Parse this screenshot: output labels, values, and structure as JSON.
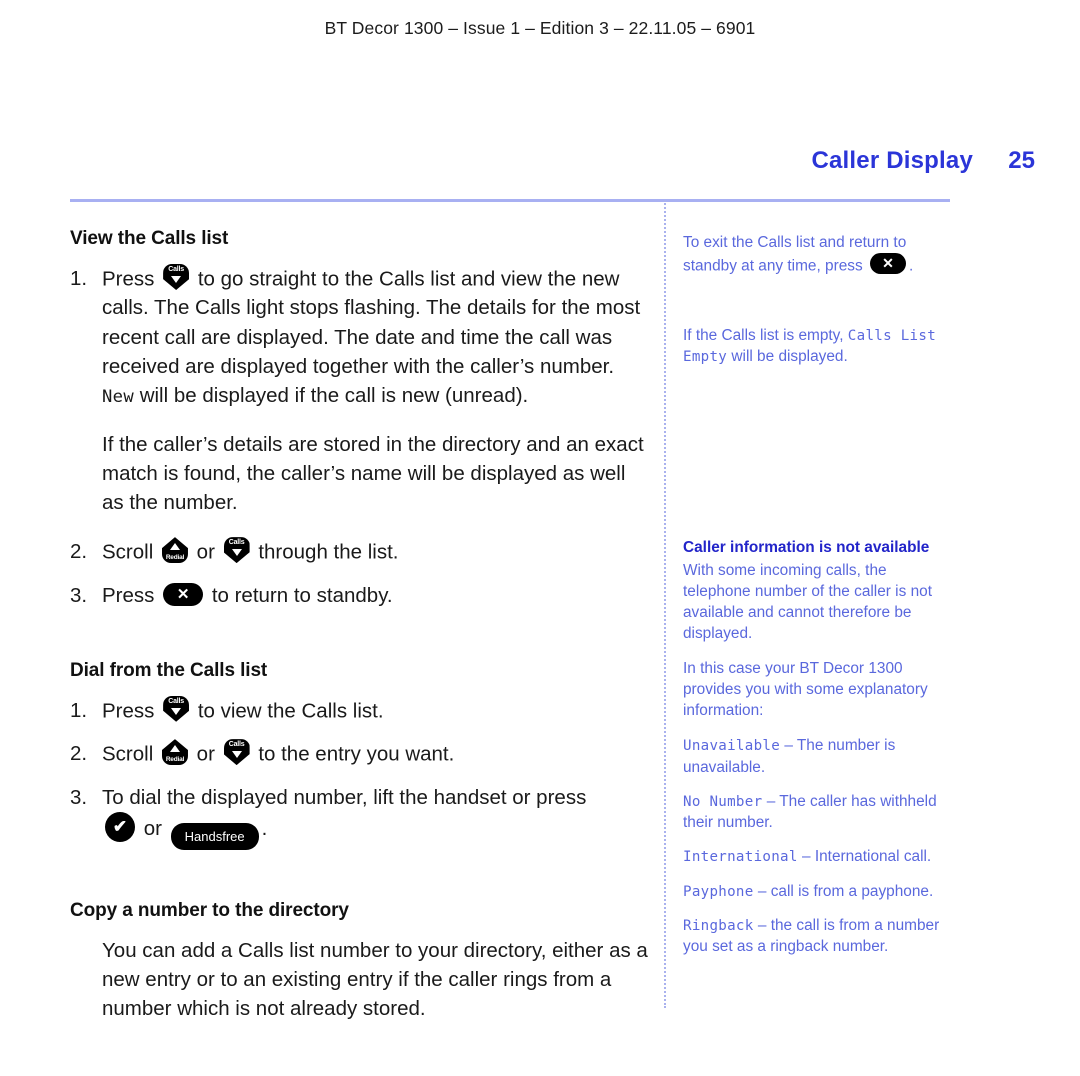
{
  "document": {
    "running_header": "BT Decor 1300 – Issue 1 – Edition 3 – 22.11.05 – 6901",
    "page_title": "Caller Display",
    "page_number": "25"
  },
  "colors": {
    "title_blue": "#2b35d8",
    "rule_blue": "#a8b0f2",
    "side_text_blue": "#5a68dd",
    "side_head_blue": "#2224c9",
    "key_black": "#000000"
  },
  "keys": {
    "calls_label": "Calls",
    "redial_label": "Redial",
    "cancel_glyph": "✕",
    "talk_glyph": "✔",
    "handsfree_label": "Handsfree"
  },
  "main": {
    "sections": [
      {
        "heading": "View the Calls list",
        "steps": [
          {
            "number": "1.",
            "text_before": "Press",
            "key": "calls",
            "text_after_a": "to go straight to the Calls list and view the new calls. The Calls light stops flashing. The details for the most recent call are displayed. The date and time the call was received are displayed together with the caller’s number.",
            "lcd": "New",
            "text_after_b": "will be displayed if the call is new (unread)."
          }
        ],
        "paragraph": "If the caller’s details are stored in the directory and an exact match is found, the caller’s name will be displayed as well as the number.",
        "steps2": [
          {
            "number": "2.",
            "text_before": "Scroll",
            "key_a": "redial",
            "conjunction": "or",
            "key_b": "calls",
            "text_after": "through the list."
          },
          {
            "number": "3.",
            "text_before": "Press",
            "key_a": "cancel",
            "text_after": "to return to standby."
          }
        ]
      },
      {
        "heading": "Dial from the Calls list",
        "steps": [
          {
            "number": "1.",
            "text_before": "Press",
            "key_a": "calls",
            "text_after": "to view the Calls list."
          },
          {
            "number": "2.",
            "text_before": "Scroll",
            "key_a": "redial",
            "conjunction": "or",
            "key_b": "calls",
            "text_after": "to the entry you want."
          },
          {
            "number": "3.",
            "text_before": "To dial the displayed number, lift the handset or press",
            "key_a": "talk",
            "conjunction": "or",
            "key_b": "handsfree",
            "text_after": "."
          }
        ]
      },
      {
        "heading": "Copy a number to the directory",
        "paragraph": "You can add a Calls list number to your directory, either as a new entry or to an existing entry if the caller rings from a number which is not already stored."
      }
    ]
  },
  "sidebar": {
    "notes": [
      {
        "text_before": "To exit the Calls list and return to standby at any time, press",
        "key": "cancel",
        "text_after": "."
      },
      {
        "text_before": "If the Calls list is empty,",
        "lcd": "Calls List Empty",
        "text_after": "will be displayed."
      }
    ],
    "caller_info": {
      "heading": "Caller information is not available",
      "paragraph1": "With some incoming calls, the telephone number of the caller is not available and cannot therefore be displayed.",
      "paragraph2": "In this case your BT Decor 1300 provides you with some explanatory information:",
      "items": [
        {
          "lcd": "Unavailable",
          "dash": "–",
          "text": "The number is unavailable."
        },
        {
          "lcd": "No Number",
          "dash": "–",
          "text": "The caller has withheld their number."
        },
        {
          "lcd": "International",
          "dash": "–",
          "text": "International call."
        },
        {
          "lcd": "Payphone",
          "dash": "–",
          "text": "call is from a payphone."
        },
        {
          "lcd": "Ringback",
          "dash": "–",
          "text": "the call is from a number you set as a ringback number."
        }
      ]
    }
  }
}
